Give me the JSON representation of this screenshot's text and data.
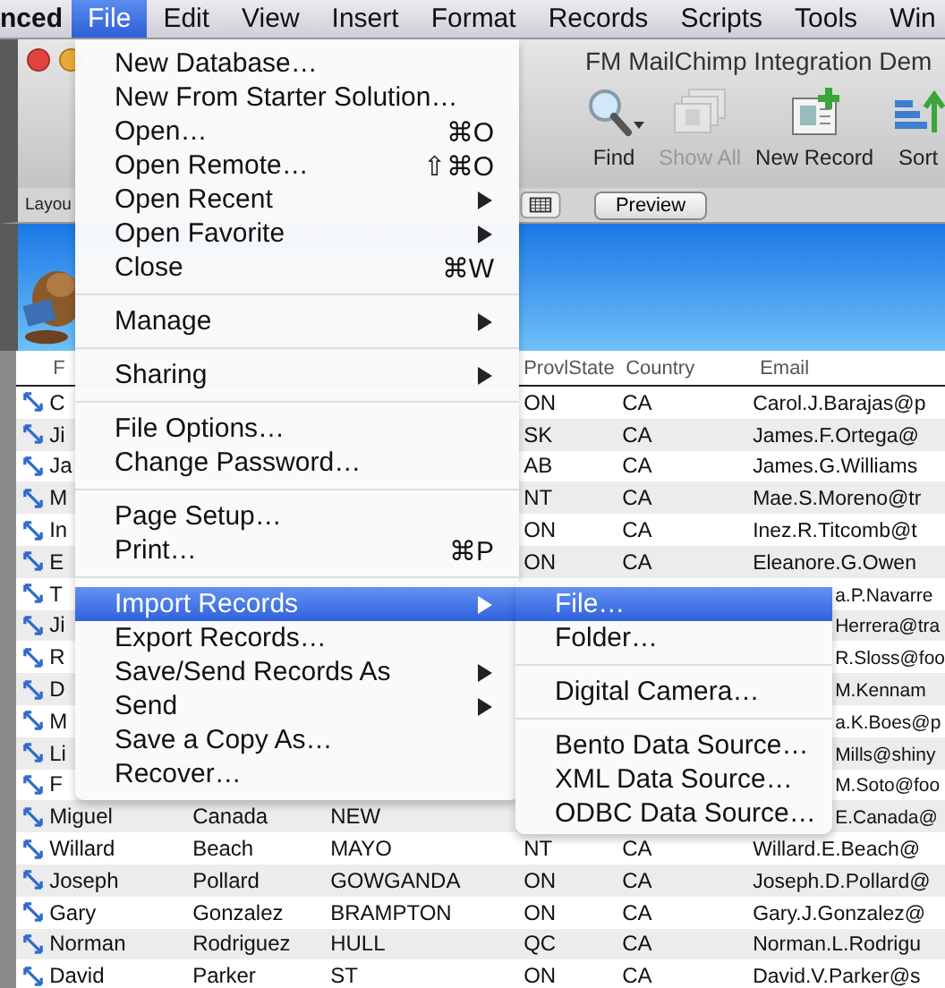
{
  "menu_bar": {
    "items": [
      {
        "kind": "app",
        "label": "nced",
        "selected": false
      },
      {
        "kind": "menu",
        "label": "File",
        "selected": true
      },
      {
        "kind": "menu",
        "label": "Edit",
        "selected": false
      },
      {
        "kind": "menu",
        "label": "View",
        "selected": false
      },
      {
        "kind": "menu",
        "label": "Insert",
        "selected": false
      },
      {
        "kind": "menu",
        "label": "Format",
        "selected": false
      },
      {
        "kind": "menu",
        "label": "Records",
        "selected": false
      },
      {
        "kind": "menu",
        "label": "Scripts",
        "selected": false
      },
      {
        "kind": "menu",
        "label": "Tools",
        "selected": false
      },
      {
        "kind": "menu",
        "label": "Win",
        "selected": false
      }
    ]
  },
  "window": {
    "title": "FM MailChimp Integration Dem",
    "toolbar": [
      {
        "label": "Find",
        "disabled": false
      },
      {
        "label": "Show All",
        "disabled": true
      },
      {
        "label": "New Record",
        "disabled": false
      },
      {
        "label": "Sort",
        "disabled": false
      }
    ]
  },
  "layout_bar": {
    "label": "Layou",
    "preview_button": "Preview"
  },
  "table": {
    "header": {
      "column_1": "F",
      "provl_state": "ProvlState",
      "country": "Country",
      "email": "Email"
    },
    "rows": [
      {
        "kind": "under_menu",
        "first": "C",
        "state": "ON",
        "country": "CA",
        "email": "Carol.J.Barajas@p"
      },
      {
        "kind": "under_menu",
        "first": "Ji",
        "state": "SK",
        "country": "CA",
        "email": "James.F.Ortega@"
      },
      {
        "kind": "under_menu",
        "first": "Ja",
        "state": "AB",
        "country": "CA",
        "email": "James.G.Williams"
      },
      {
        "kind": "under_menu",
        "first": "M",
        "state": "NT",
        "country": "CA",
        "email": "Mae.S.Moreno@tr"
      },
      {
        "kind": "under_menu",
        "first": "In",
        "state": "ON",
        "country": "CA",
        "email": "Inez.R.Titcomb@t"
      },
      {
        "kind": "under_menu",
        "first": "E",
        "state": "ON",
        "country": "CA",
        "email": "Eleanore.G.Owen"
      },
      {
        "kind": "under_submenu",
        "first": "T",
        "email": "a.P.Navarre"
      },
      {
        "kind": "under_submenu",
        "first": "Ji",
        "email": "Herrera@tra"
      },
      {
        "kind": "under_submenu",
        "first": "R",
        "email": "R.Sloss@foo"
      },
      {
        "kind": "under_submenu",
        "first": "D",
        "email": "M.Kennam"
      },
      {
        "kind": "under_submenu",
        "first": "M",
        "email": "a.K.Boes@p"
      },
      {
        "kind": "under_submenu",
        "first": "Li",
        "email": "Mills@shiny"
      },
      {
        "kind": "under_submenu",
        "first": "F",
        "email": "M.Soto@foo"
      },
      {
        "kind": "partial",
        "first": "Miguel",
        "last": "Canada",
        "city": "NEW",
        "email": "E.Canada@"
      },
      {
        "kind": "full",
        "first": "Willard",
        "last": "Beach",
        "city": "MAYO",
        "state": "NT",
        "country": "CA",
        "email": "Willard.E.Beach@"
      },
      {
        "kind": "full",
        "first": "Joseph",
        "last": "Pollard",
        "city": "GOWGANDA",
        "state": "ON",
        "country": "CA",
        "email": "Joseph.D.Pollard@"
      },
      {
        "kind": "full",
        "first": "Gary",
        "last": "Gonzalez",
        "city": "BRAMPTON",
        "state": "ON",
        "country": "CA",
        "email": "Gary.J.Gonzalez@"
      },
      {
        "kind": "full",
        "first": "Norman",
        "last": "Rodriguez",
        "city": "HULL",
        "state": "QC",
        "country": "CA",
        "email": "Norman.L.Rodrigu"
      },
      {
        "kind": "full",
        "first": "David",
        "last": "Parker",
        "city": "ST",
        "state": "ON",
        "country": "CA",
        "email": "David.V.Parker@s"
      }
    ]
  },
  "file_menu": {
    "items": [
      {
        "kind": "item",
        "label": "New Database…",
        "selected": false
      },
      {
        "kind": "item",
        "label": "New From Starter Solution…",
        "selected": false
      },
      {
        "kind": "item",
        "label": "Open…",
        "shortcut": "⌘O",
        "selected": false
      },
      {
        "kind": "item",
        "label": "Open Remote…",
        "shortcut": "⇧⌘O",
        "selected": false
      },
      {
        "kind": "item",
        "label": "Open Recent",
        "submenu": true,
        "selected": false
      },
      {
        "kind": "item",
        "label": "Open Favorite",
        "submenu": true,
        "selected": false
      },
      {
        "kind": "item",
        "label": "Close",
        "shortcut": "⌘W",
        "selected": false
      },
      {
        "kind": "separator"
      },
      {
        "kind": "item",
        "label": "Manage",
        "submenu": true,
        "selected": false
      },
      {
        "kind": "separator"
      },
      {
        "kind": "item",
        "label": "Sharing",
        "submenu": true,
        "selected": false
      },
      {
        "kind": "separator"
      },
      {
        "kind": "item",
        "label": "File Options…",
        "selected": false
      },
      {
        "kind": "item",
        "label": "Change Password…",
        "selected": false
      },
      {
        "kind": "separator"
      },
      {
        "kind": "item",
        "label": "Page Setup…",
        "selected": false
      },
      {
        "kind": "item",
        "label": "Print…",
        "shortcut": "⌘P",
        "selected": false
      },
      {
        "kind": "separator"
      },
      {
        "kind": "item",
        "label": "Import Records",
        "submenu": true,
        "selected": true
      },
      {
        "kind": "item",
        "label": "Export Records…",
        "selected": false
      },
      {
        "kind": "item",
        "label": "Save/Send Records As",
        "submenu": true,
        "selected": false
      },
      {
        "kind": "item",
        "label": "Send",
        "submenu": true,
        "selected": false
      },
      {
        "kind": "item",
        "label": "Save a Copy As…",
        "selected": false
      },
      {
        "kind": "item",
        "label": "Recover…",
        "selected": false
      }
    ]
  },
  "import_submenu": {
    "items": [
      {
        "kind": "item",
        "label": "File…",
        "selected": true
      },
      {
        "kind": "item",
        "label": "Folder…",
        "selected": false
      },
      {
        "kind": "separator"
      },
      {
        "kind": "item",
        "label": "Digital Camera…",
        "selected": false
      },
      {
        "kind": "separator"
      },
      {
        "kind": "item",
        "label": "Bento Data Source…",
        "selected": false
      },
      {
        "kind": "item",
        "label": "XML Data Source…",
        "selected": false
      },
      {
        "kind": "item",
        "label": "ODBC Data Source…",
        "selected": false
      }
    ]
  }
}
